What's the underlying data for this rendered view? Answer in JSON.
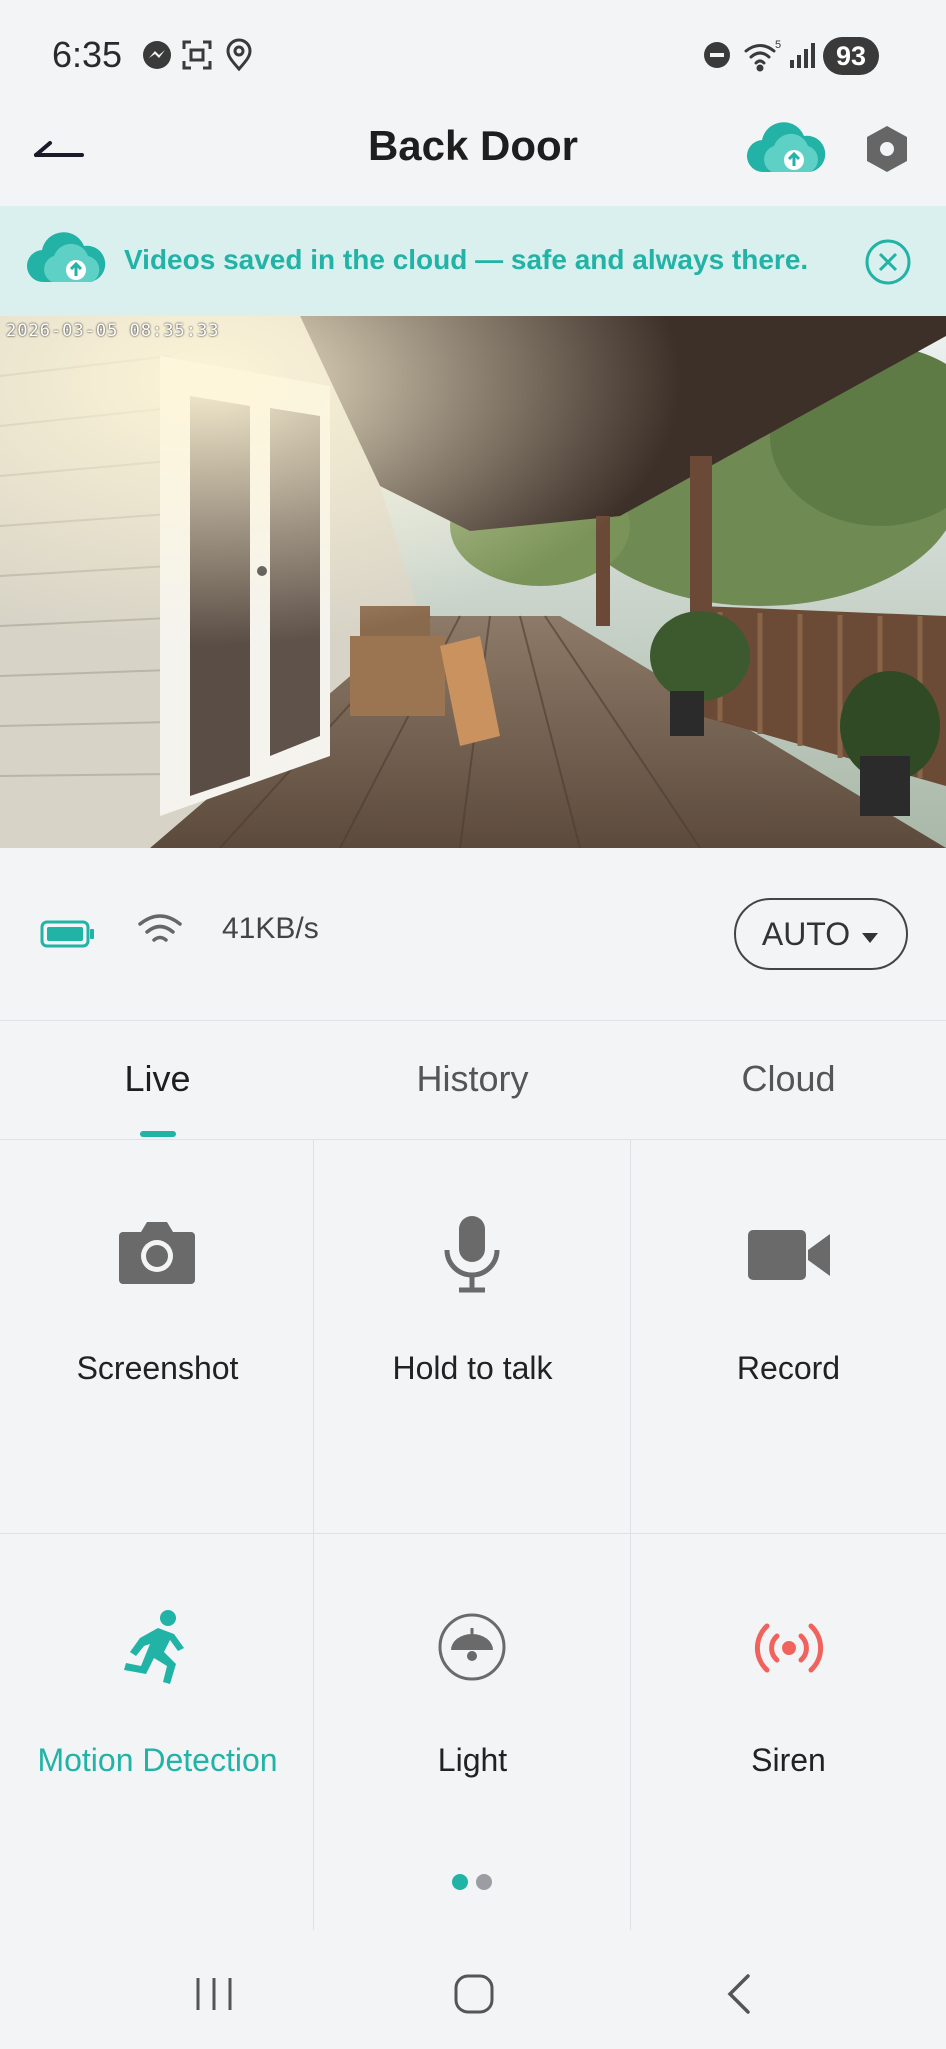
{
  "status_bar": {
    "time": "6:35",
    "battery": "93",
    "icons": [
      "messenger-icon",
      "screenshot-icon",
      "location-icon",
      "dnd-icon",
      "wifi-icon",
      "signal-icon"
    ]
  },
  "header": {
    "title": "Back Door",
    "back_icon": "back-arrow-icon",
    "cloud_icon": "cloud-upload-icon",
    "settings_icon": "hexagon-settings-icon"
  },
  "banner": {
    "text": "Videos saved in the cloud — safe and always there.",
    "close_icon": "close-circle-icon"
  },
  "video": {
    "timestamp": "2026-03-05 08:35:33"
  },
  "info": {
    "speed": "41KB/s",
    "quality": "AUTO"
  },
  "tabs": [
    {
      "label": "Live",
      "active": true
    },
    {
      "label": "History",
      "active": false
    },
    {
      "label": "Cloud",
      "active": false
    }
  ],
  "controls": [
    {
      "label": "Screenshot",
      "icon": "camera-icon"
    },
    {
      "label": "Hold to talk",
      "icon": "microphone-icon"
    },
    {
      "label": "Record",
      "icon": "video-camera-icon"
    },
    {
      "label": "Motion Detection",
      "icon": "running-person-icon",
      "active": true
    },
    {
      "label": "Light",
      "icon": "lamp-icon"
    },
    {
      "label": "Siren",
      "icon": "siren-icon"
    }
  ],
  "pager": {
    "total": 2,
    "current": 1
  },
  "colors": {
    "accent": "#21b3a6",
    "siren": "#f2625d",
    "banner_bg": "#d9f0ef",
    "background": "#f2f4f6"
  }
}
